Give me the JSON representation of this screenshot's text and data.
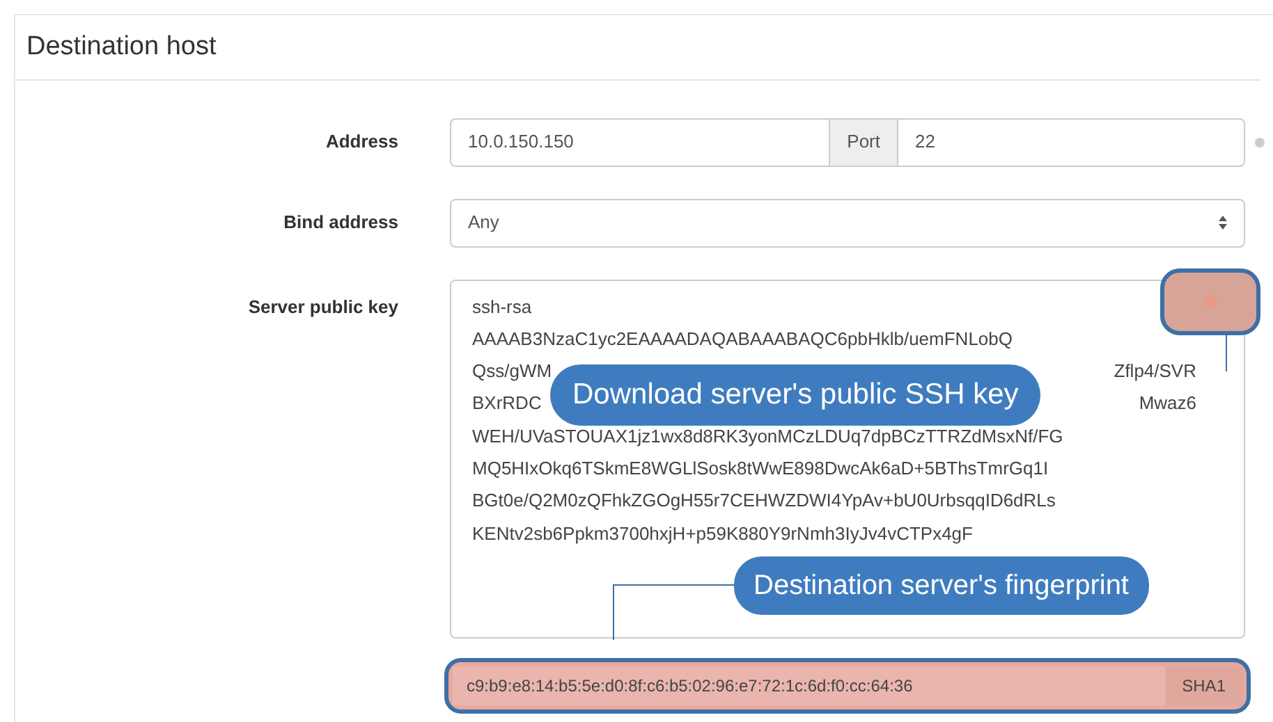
{
  "section": {
    "title": "Destination host"
  },
  "address": {
    "label": "Address",
    "value": "10.0.150.150",
    "port_label": "Port",
    "port_value": "22"
  },
  "bind_address": {
    "label": "Bind address",
    "value": "Any"
  },
  "public_key": {
    "label": "Server public key",
    "lines": [
      {
        "parts": [
          "ssh-rsa"
        ]
      },
      {
        "parts": [
          "AAAAB3NzaC1yc2EAAAADAQABAAABAQC6pbHklb/uemFNLobQ"
        ]
      },
      {
        "parts": [
          "Qss/gWM",
          "Zflp4/SVR"
        ]
      },
      {
        "parts": [
          "BXrRDC",
          "Mwaz6"
        ]
      },
      {
        "parts": [
          "WEH/UVaSTOUAX1jz1wx8d8RK3yonMCzLDUq7dpBCzTTRZdMsxNf/FG"
        ]
      },
      {
        "parts": [
          "MQ5HIxOkq6TSkmE8WGLlSosk8tWwE898DwcAk6aD+5BThsTmrGq1I"
        ]
      },
      {
        "parts": [
          "BGt0e/Q2M0zQFhkZGOgH55r7CEHWZDWI4YpAv+bU0UrbsqqID6dRLs"
        ]
      },
      {
        "parts": [
          "KENtv2sb6Ppkm3700hxjH+p59K880Y9rNmh3IyJv4vCTPx4gF"
        ]
      }
    ],
    "fingerprint": "c9:b9:e8:14:b5:5e:d0:8f:c6:b5:02:96:e7:72:1c:6d:f0:cc:64:36",
    "algorithm": "SHA1"
  },
  "callouts": [
    {
      "text": "Download server's public SSH key"
    },
    {
      "text": "Destination server's fingerprint"
    }
  ]
}
